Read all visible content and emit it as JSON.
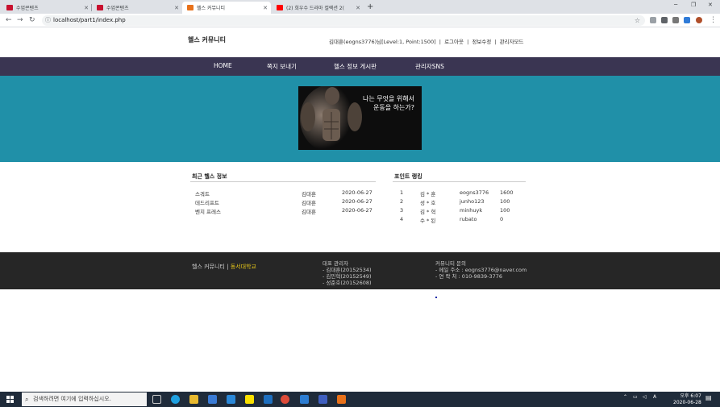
{
  "browser": {
    "tabs": [
      {
        "title": "수업콘텐츠",
        "active": false,
        "favicon_color": "#c8102e"
      },
      {
        "title": "수업콘텐츠",
        "active": false,
        "favicon_color": "#c8102e"
      },
      {
        "title": "헬스 커뮤니티",
        "active": true,
        "favicon_color": "#e8711a"
      },
      {
        "title": "(2) 희우수 드라마 컬렉션 2(",
        "active": false,
        "favicon_color": "#ff0000"
      }
    ],
    "url": "localhost/part1/index.php"
  },
  "header": {
    "site_title": "헬스 커뮤니티",
    "user_text": "김대훈(eogns3776)님[Level:1, Point:1500]",
    "sep": "|",
    "logout": "로그아웃",
    "edit_info": "정보수정",
    "admin_mode": "관리자모드"
  },
  "menu": [
    "HOME",
    "쪽지 보내기",
    "헬스 정보 게시판",
    "관리자SNS"
  ],
  "banner": {
    "line1": "나는 무엇을 위해서",
    "line2": "운동을 하는가?"
  },
  "recent": {
    "title": "최근 헬스 정보",
    "rows": [
      {
        "subject": "스쿼트",
        "author": "김대훈",
        "date": "2020-06-27"
      },
      {
        "subject": "데드리프트",
        "author": "김대훈",
        "date": "2020-06-27"
      },
      {
        "subject": "벤치 프레스",
        "author": "김대훈",
        "date": "2020-06-27"
      }
    ]
  },
  "ranking": {
    "title": "포인트 랭킹",
    "rows": [
      {
        "rank": "1",
        "name": "김 * 훈",
        "id": "eogns3776",
        "point": "1600"
      },
      {
        "rank": "2",
        "name": "성 * 호",
        "id": "junho123",
        "point": "100"
      },
      {
        "rank": "3",
        "name": "김 * 혁",
        "id": "minhuyk",
        "point": "100"
      },
      {
        "rank": "4",
        "name": "수 * 된",
        "id": "rubato",
        "point": "0"
      }
    ]
  },
  "footer": {
    "site": "헬스 커뮤니티",
    "sep": "|",
    "school": "동서대학교",
    "admin_title": "대표 관리자",
    "admins": [
      "- 김대훈(20152534)",
      "- 김민혁(20152549)",
      "- 성준호(20152608)"
    ],
    "contact_title": "커뮤니티 문의",
    "email": "- 메일 주소 : eogns3776@naver.com",
    "phone": "- 연 락 처 : 010-9839-3776"
  },
  "taskbar": {
    "search_placeholder": "검색하려면 여기에 입력하십시오.",
    "time": "오후 6:07",
    "date": "2020-06-28",
    "lang": "A"
  },
  "colors": {
    "menu": "#3a3552",
    "hero": "#2090a8",
    "footer": "#262626",
    "school": "#e6c619"
  }
}
